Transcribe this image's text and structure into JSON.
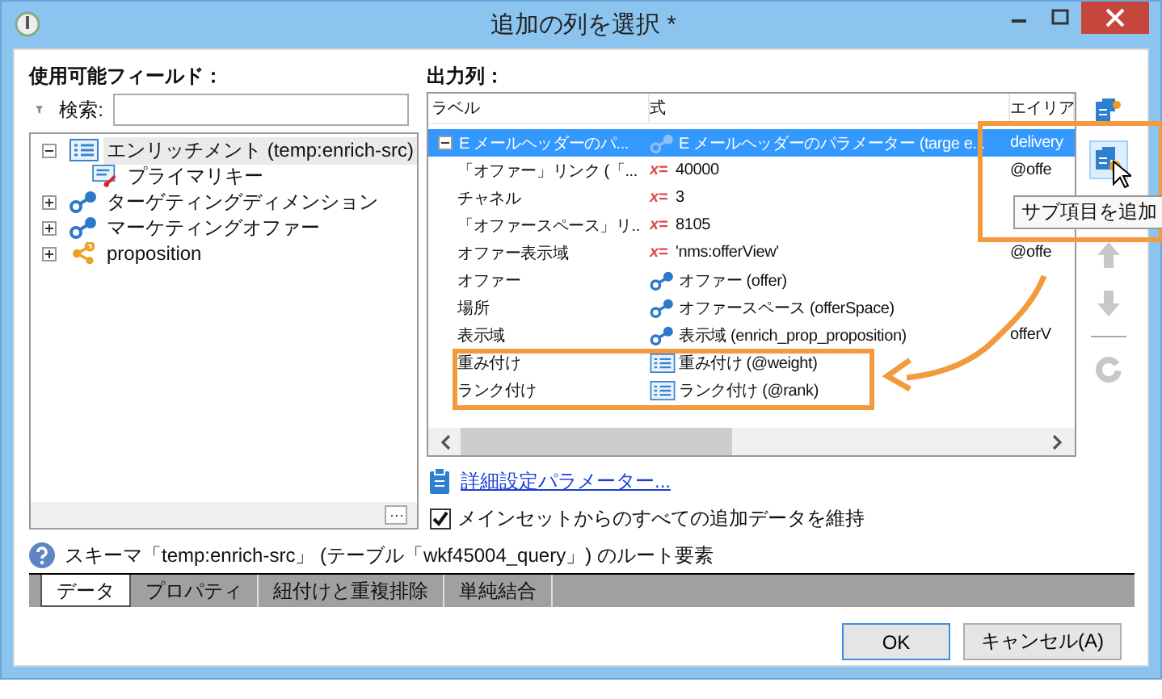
{
  "window": {
    "title": "追加の列を選択 *"
  },
  "available_fields": {
    "label": "使用可能フィールド：",
    "search_label": "検索:",
    "tree": [
      {
        "label": "エンリッチメント (temp:enrich-src)",
        "kind": "list",
        "expanded": true,
        "selected": true,
        "children": [
          {
            "label": "プライマリキー",
            "kind": "key",
            "selected": false
          }
        ]
      },
      {
        "label": "ターゲティングディメンション",
        "kind": "link",
        "expanded": false,
        "selected": false
      },
      {
        "label": "マーケティングオファー",
        "kind": "link",
        "expanded": false,
        "selected": false
      },
      {
        "label": "proposition",
        "kind": "share",
        "expanded": false,
        "selected": false
      }
    ]
  },
  "output_columns": {
    "label": "出力列：",
    "columns": [
      "ラベル",
      "式",
      "エイリア"
    ],
    "rows": [
      {
        "label": "E メールヘッダーのパ...",
        "kind": "link",
        "expression": "E メールヘッダーのパラメーター (targe e...",
        "alias": "delivery",
        "expanded": true,
        "selected": true,
        "children": [
          {
            "label": "「オファー」リンク (「...",
            "kind": "formula",
            "symbol": "x=",
            "expression": "40000",
            "alias": "@offe",
            "selected": false
          },
          {
            "label": "チャネル",
            "kind": "formula",
            "symbol": "x=",
            "expression": "3",
            "selected": false
          },
          {
            "label": "「オファースペース」リ..",
            "kind": "formula",
            "symbol": "x=",
            "expression": "8105",
            "selected": false
          },
          {
            "label": "オファー表示域",
            "kind": "formula",
            "symbol": "x=",
            "expression": "'nms:offerView'",
            "alias": "@offe",
            "selected": false
          },
          {
            "label": "オファー",
            "kind": "link",
            "expression": "オファー (offer)",
            "selected": false
          },
          {
            "label": "場所",
            "kind": "link",
            "expression": "オファースペース (offerSpace)",
            "selected": false
          },
          {
            "label": "表示域",
            "kind": "link",
            "expression": "表示域 (enrich_prop_proposition)",
            "alias": "offerV",
            "selected": false
          },
          {
            "label": "重み付け",
            "kind": "list",
            "expression": "重み付け (@weight)",
            "selected": false
          },
          {
            "label": "ランク付け",
            "kind": "list",
            "expression": "ランク付け (@rank)",
            "selected": false
          }
        ]
      }
    ]
  },
  "toolbar": [
    {
      "kind": "add",
      "disabled": false,
      "hovered": false
    },
    {
      "kind": "add_sub",
      "disabled": false,
      "hovered": true
    },
    {
      "kind": "up",
      "disabled": true,
      "hovered": false
    },
    {
      "kind": "down",
      "disabled": true,
      "hovered": false
    },
    {
      "kind": "refresh",
      "disabled": true,
      "hovered": false
    }
  ],
  "tooltip": "サブ項目を追加",
  "advanced_link": "詳細設定パラメーター...",
  "keep_checkbox": {
    "label": "メインセットからのすべての追加データを維持",
    "checked": true
  },
  "help_text": "スキーマ「temp:enrich-src」 (テーブル「wkf45004_query」) のルート要素",
  "tabs": [
    {
      "label": "データ",
      "selected": true
    },
    {
      "label": "プロパティ",
      "selected": false
    },
    {
      "label": "紐付けと重複排除",
      "selected": false
    },
    {
      "label": "単純結合",
      "selected": false
    }
  ],
  "buttons": [
    {
      "label": "OK",
      "default": true
    },
    {
      "label": "キャンセル(A)",
      "default": false
    }
  ]
}
